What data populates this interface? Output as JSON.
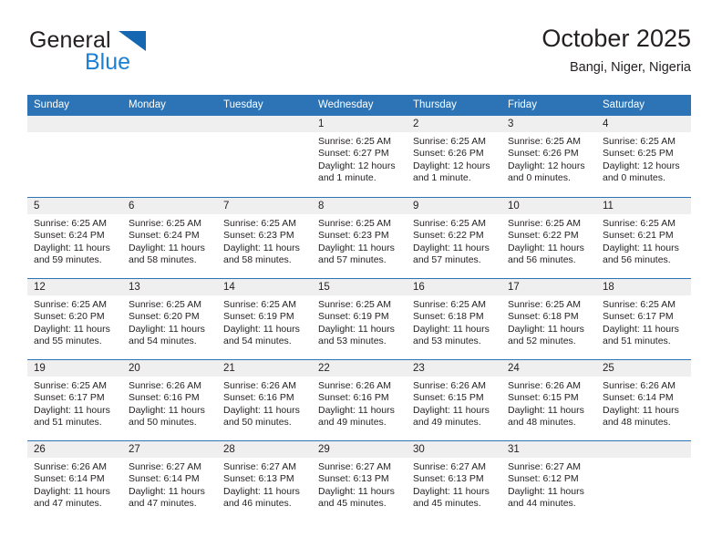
{
  "logo": {
    "word_one": "General",
    "word_two": "Blue",
    "triangle_color": "#1567b2",
    "blue_text_color": "#1b7fd4",
    "icon": "general-blue-logo"
  },
  "header": {
    "title": "October 2025",
    "subtitle": "Bangi, Niger, Nigeria"
  },
  "theme": {
    "header_blue": "#2c74b6",
    "day_band_gray": "#efefef",
    "text_color": "#231f20"
  },
  "weekdays": [
    "Sunday",
    "Monday",
    "Tuesday",
    "Wednesday",
    "Thursday",
    "Friday",
    "Saturday"
  ],
  "weeks": [
    [
      {
        "day": "",
        "empty": true
      },
      {
        "day": "",
        "empty": true
      },
      {
        "day": "",
        "empty": true
      },
      {
        "day": "1",
        "sunrise": "Sunrise: 6:25 AM",
        "sunset": "Sunset: 6:27 PM",
        "daylight": "Daylight: 12 hours and 1 minute."
      },
      {
        "day": "2",
        "sunrise": "Sunrise: 6:25 AM",
        "sunset": "Sunset: 6:26 PM",
        "daylight": "Daylight: 12 hours and 1 minute."
      },
      {
        "day": "3",
        "sunrise": "Sunrise: 6:25 AM",
        "sunset": "Sunset: 6:26 PM",
        "daylight": "Daylight: 12 hours and 0 minutes."
      },
      {
        "day": "4",
        "sunrise": "Sunrise: 6:25 AM",
        "sunset": "Sunset: 6:25 PM",
        "daylight": "Daylight: 12 hours and 0 minutes."
      }
    ],
    [
      {
        "day": "5",
        "sunrise": "Sunrise: 6:25 AM",
        "sunset": "Sunset: 6:24 PM",
        "daylight": "Daylight: 11 hours and 59 minutes."
      },
      {
        "day": "6",
        "sunrise": "Sunrise: 6:25 AM",
        "sunset": "Sunset: 6:24 PM",
        "daylight": "Daylight: 11 hours and 58 minutes."
      },
      {
        "day": "7",
        "sunrise": "Sunrise: 6:25 AM",
        "sunset": "Sunset: 6:23 PM",
        "daylight": "Daylight: 11 hours and 58 minutes."
      },
      {
        "day": "8",
        "sunrise": "Sunrise: 6:25 AM",
        "sunset": "Sunset: 6:23 PM",
        "daylight": "Daylight: 11 hours and 57 minutes."
      },
      {
        "day": "9",
        "sunrise": "Sunrise: 6:25 AM",
        "sunset": "Sunset: 6:22 PM",
        "daylight": "Daylight: 11 hours and 57 minutes."
      },
      {
        "day": "10",
        "sunrise": "Sunrise: 6:25 AM",
        "sunset": "Sunset: 6:22 PM",
        "daylight": "Daylight: 11 hours and 56 minutes."
      },
      {
        "day": "11",
        "sunrise": "Sunrise: 6:25 AM",
        "sunset": "Sunset: 6:21 PM",
        "daylight": "Daylight: 11 hours and 56 minutes."
      }
    ],
    [
      {
        "day": "12",
        "sunrise": "Sunrise: 6:25 AM",
        "sunset": "Sunset: 6:20 PM",
        "daylight": "Daylight: 11 hours and 55 minutes."
      },
      {
        "day": "13",
        "sunrise": "Sunrise: 6:25 AM",
        "sunset": "Sunset: 6:20 PM",
        "daylight": "Daylight: 11 hours and 54 minutes."
      },
      {
        "day": "14",
        "sunrise": "Sunrise: 6:25 AM",
        "sunset": "Sunset: 6:19 PM",
        "daylight": "Daylight: 11 hours and 54 minutes."
      },
      {
        "day": "15",
        "sunrise": "Sunrise: 6:25 AM",
        "sunset": "Sunset: 6:19 PM",
        "daylight": "Daylight: 11 hours and 53 minutes."
      },
      {
        "day": "16",
        "sunrise": "Sunrise: 6:25 AM",
        "sunset": "Sunset: 6:18 PM",
        "daylight": "Daylight: 11 hours and 53 minutes."
      },
      {
        "day": "17",
        "sunrise": "Sunrise: 6:25 AM",
        "sunset": "Sunset: 6:18 PM",
        "daylight": "Daylight: 11 hours and 52 minutes."
      },
      {
        "day": "18",
        "sunrise": "Sunrise: 6:25 AM",
        "sunset": "Sunset: 6:17 PM",
        "daylight": "Daylight: 11 hours and 51 minutes."
      }
    ],
    [
      {
        "day": "19",
        "sunrise": "Sunrise: 6:25 AM",
        "sunset": "Sunset: 6:17 PM",
        "daylight": "Daylight: 11 hours and 51 minutes."
      },
      {
        "day": "20",
        "sunrise": "Sunrise: 6:26 AM",
        "sunset": "Sunset: 6:16 PM",
        "daylight": "Daylight: 11 hours and 50 minutes."
      },
      {
        "day": "21",
        "sunrise": "Sunrise: 6:26 AM",
        "sunset": "Sunset: 6:16 PM",
        "daylight": "Daylight: 11 hours and 50 minutes."
      },
      {
        "day": "22",
        "sunrise": "Sunrise: 6:26 AM",
        "sunset": "Sunset: 6:16 PM",
        "daylight": "Daylight: 11 hours and 49 minutes."
      },
      {
        "day": "23",
        "sunrise": "Sunrise: 6:26 AM",
        "sunset": "Sunset: 6:15 PM",
        "daylight": "Daylight: 11 hours and 49 minutes."
      },
      {
        "day": "24",
        "sunrise": "Sunrise: 6:26 AM",
        "sunset": "Sunset: 6:15 PM",
        "daylight": "Daylight: 11 hours and 48 minutes."
      },
      {
        "day": "25",
        "sunrise": "Sunrise: 6:26 AM",
        "sunset": "Sunset: 6:14 PM",
        "daylight": "Daylight: 11 hours and 48 minutes."
      }
    ],
    [
      {
        "day": "26",
        "sunrise": "Sunrise: 6:26 AM",
        "sunset": "Sunset: 6:14 PM",
        "daylight": "Daylight: 11 hours and 47 minutes."
      },
      {
        "day": "27",
        "sunrise": "Sunrise: 6:27 AM",
        "sunset": "Sunset: 6:14 PM",
        "daylight": "Daylight: 11 hours and 47 minutes."
      },
      {
        "day": "28",
        "sunrise": "Sunrise: 6:27 AM",
        "sunset": "Sunset: 6:13 PM",
        "daylight": "Daylight: 11 hours and 46 minutes."
      },
      {
        "day": "29",
        "sunrise": "Sunrise: 6:27 AM",
        "sunset": "Sunset: 6:13 PM",
        "daylight": "Daylight: 11 hours and 45 minutes."
      },
      {
        "day": "30",
        "sunrise": "Sunrise: 6:27 AM",
        "sunset": "Sunset: 6:13 PM",
        "daylight": "Daylight: 11 hours and 45 minutes."
      },
      {
        "day": "31",
        "sunrise": "Sunrise: 6:27 AM",
        "sunset": "Sunset: 6:12 PM",
        "daylight": "Daylight: 11 hours and 44 minutes."
      },
      {
        "day": "",
        "empty": true
      }
    ]
  ]
}
